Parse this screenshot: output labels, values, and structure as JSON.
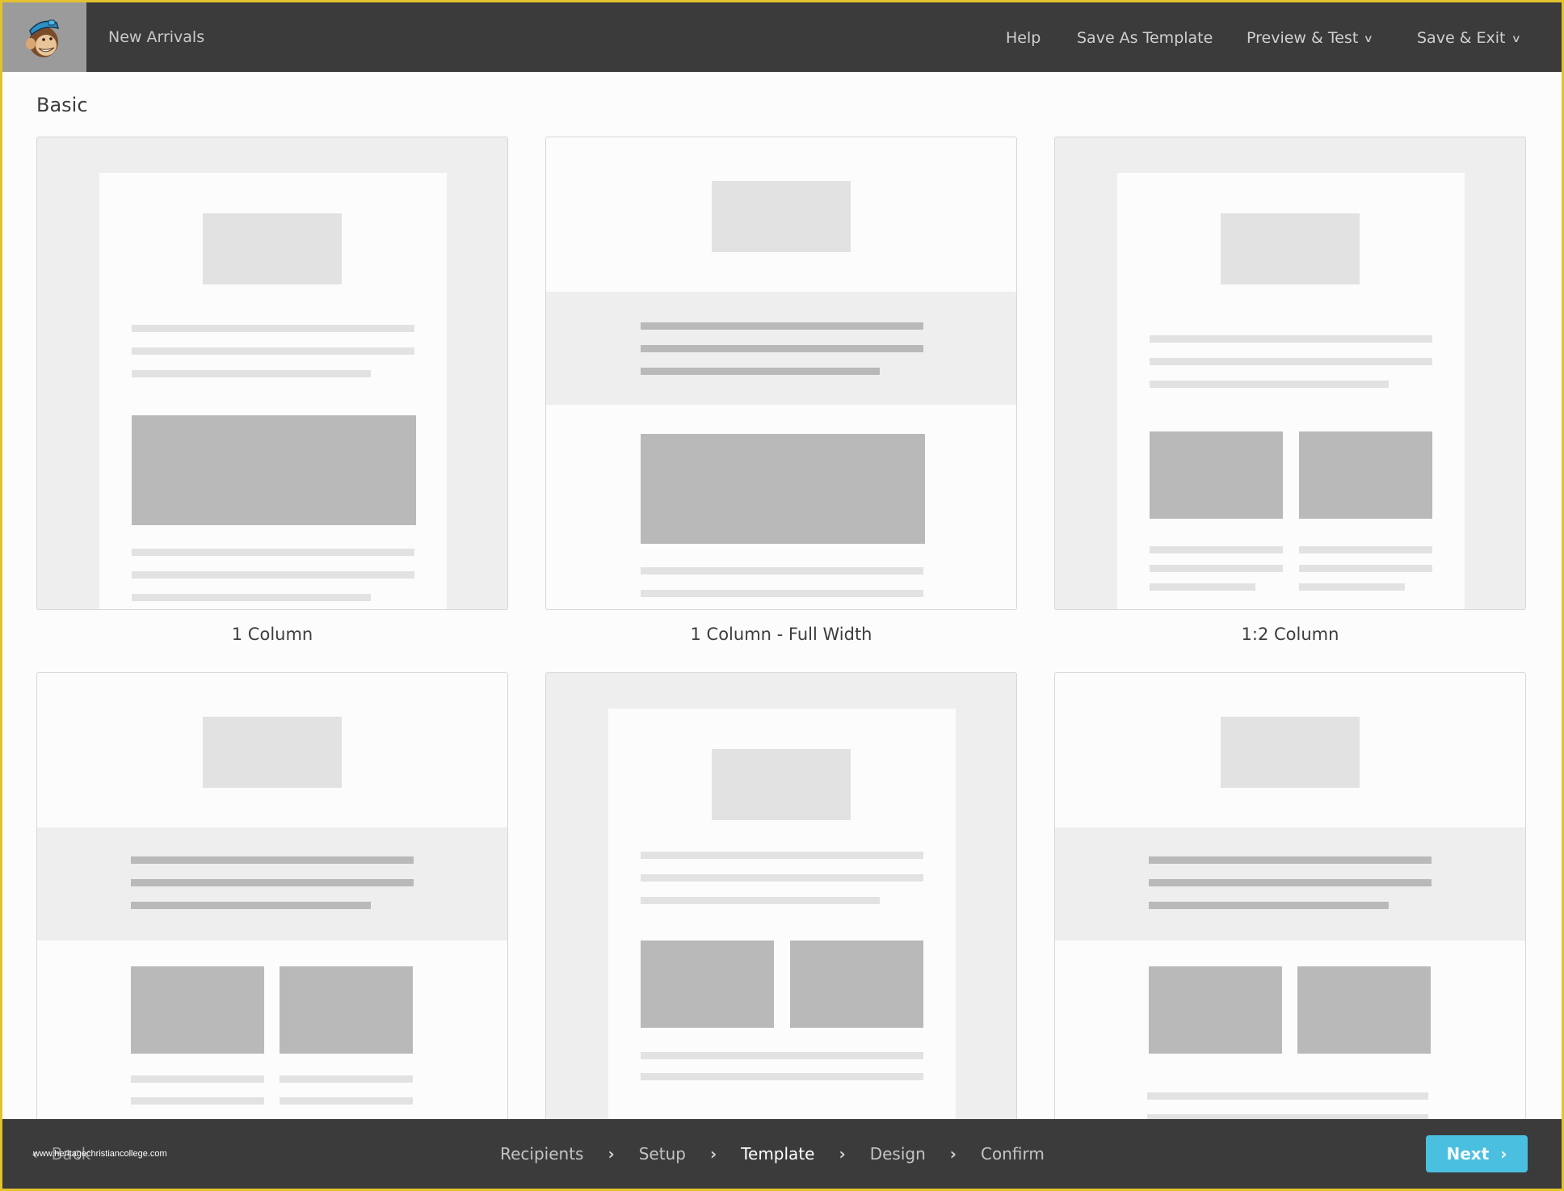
{
  "header": {
    "logo_icon": "mailchimp-freddie-logo",
    "campaign_title": "New Arrivals",
    "nav": {
      "help": "Help",
      "save_as_template": "Save As Template",
      "preview_test": "Preview & Test",
      "save_exit": "Save & Exit"
    },
    "dropdown_icon": "chevron-down-icon"
  },
  "section": {
    "title": "Basic"
  },
  "templates": [
    {
      "label": "1 Column"
    },
    {
      "label": "1 Column - Full Width"
    },
    {
      "label": "1:2 Column"
    },
    {
      "label": ""
    },
    {
      "label": ""
    },
    {
      "label": ""
    }
  ],
  "footer": {
    "back_label": "Back",
    "watermark": "www.heritagechristiancollege.com",
    "steps": [
      "Recipients",
      "Setup",
      "Template",
      "Design",
      "Confirm"
    ],
    "active_step": "Template",
    "separator_icon": "chevron-right-icon",
    "next_label": "Next"
  },
  "colors": {
    "header_bg": "#3b3b3b",
    "logo_bg": "#9b9b9b",
    "frame": "#e3c22d",
    "next_button": "#4bbfdf",
    "placeholder_light": "#e2e2e2",
    "placeholder_dark": "#b9b9b9",
    "panel_gray": "#eeeeee"
  }
}
